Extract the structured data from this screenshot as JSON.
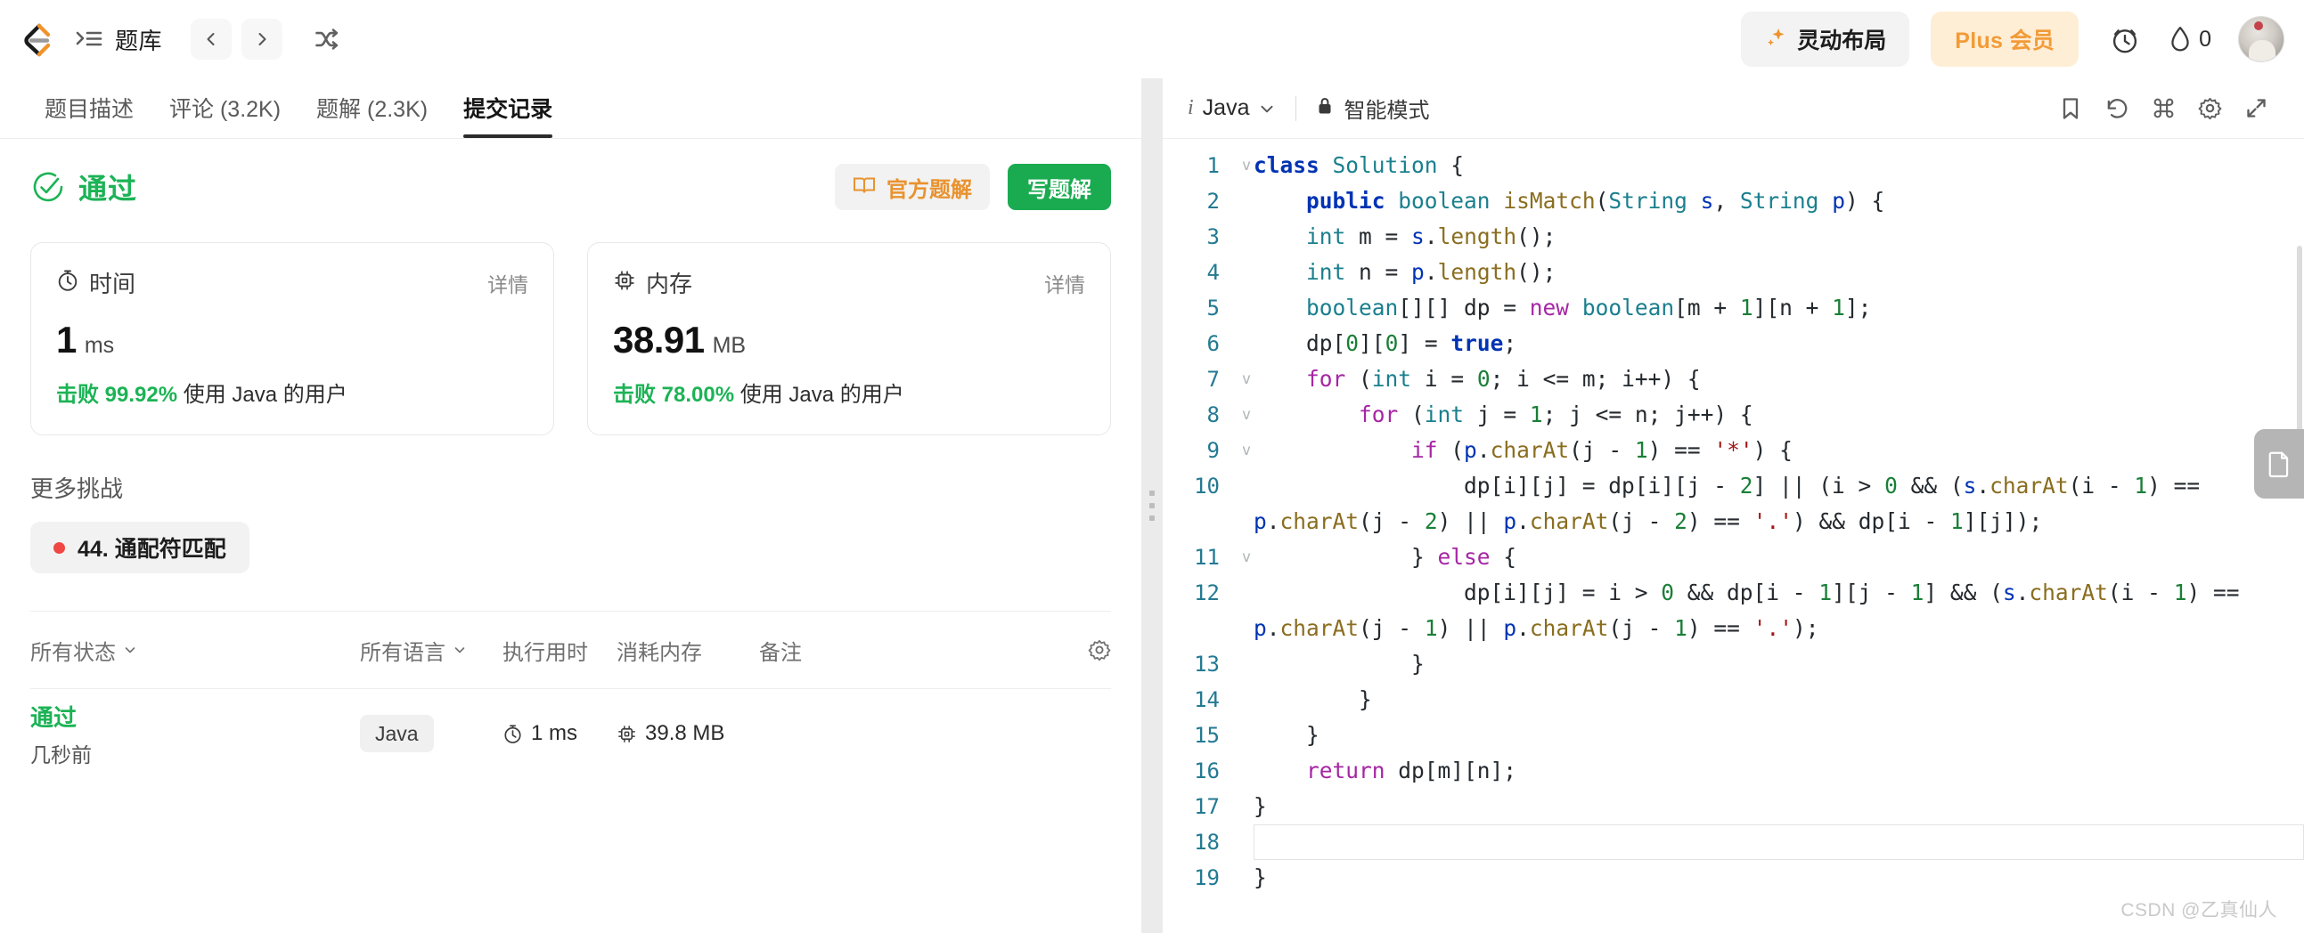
{
  "topbar": {
    "logo_icon": "leetcode-logo",
    "menu_icon": "list-menu-icon",
    "menu_label": "题库",
    "prev_icon": "chevron-left-icon",
    "next_icon": "chevron-right-icon",
    "shuffle_icon": "shuffle-icon",
    "layout_button": {
      "icon": "sparkle-icon",
      "label": "灵动布局"
    },
    "plus_button": {
      "label": "Plus 会员"
    },
    "timer_icon": "alarm-clock-icon",
    "streak": {
      "icon": "flame-icon",
      "count": "0"
    },
    "avatar_icon": "user-avatar"
  },
  "tabs": [
    {
      "label": "题目描述",
      "active": false
    },
    {
      "label": "评论 (3.2K)",
      "active": false
    },
    {
      "label": "题解 (2.3K)",
      "active": false
    },
    {
      "label": "提交记录",
      "active": true
    }
  ],
  "result": {
    "status_icon": "check-circle-icon",
    "status_label": "通过",
    "official_button": {
      "icon": "book-icon",
      "label": "官方题解"
    },
    "write_button": {
      "label": "写题解"
    }
  },
  "stats": [
    {
      "icon": "stopwatch-icon",
      "title": "时间",
      "details_label": "详情",
      "value": "1",
      "unit": "ms",
      "beat_prefix": "击败 99.92%",
      "beat_suffix": "使用 Java 的用户"
    },
    {
      "icon": "memory-chip-icon",
      "title": "内存",
      "details_label": "详情",
      "value": "38.91",
      "unit": "MB",
      "beat_prefix": "击败 78.00%",
      "beat_suffix": "使用 Java 的用户"
    }
  ],
  "more_challenges": {
    "heading": "更多挑战",
    "items": [
      {
        "difficulty_color": "#ef4743",
        "label": "44. 通配符匹配"
      }
    ]
  },
  "submissions": {
    "headers": {
      "status": "所有状态",
      "language": "所有语言",
      "runtime": "执行用时",
      "memory": "消耗内存",
      "note": "备注",
      "settings_icon": "gear-icon",
      "caret_icon": "chevron-down-icon"
    },
    "rows": [
      {
        "status": "通过",
        "time_ago": "几秒前",
        "language": "Java",
        "runtime": "1 ms",
        "runtime_icon": "stopwatch-icon",
        "memory": "39.8 MB",
        "memory_icon": "memory-chip-icon",
        "note": ""
      }
    ]
  },
  "editor": {
    "info_icon": "info-icon",
    "language": "Java",
    "lang_caret": "chevron-down-icon",
    "lock_icon": "lock-icon",
    "mode_label": "智能模式",
    "actions": [
      {
        "icon": "bookmark-icon"
      },
      {
        "icon": "history-undo-icon"
      },
      {
        "icon": "command-icon"
      },
      {
        "icon": "gear-icon"
      },
      {
        "icon": "expand-icon"
      }
    ],
    "file_tab_icon": "document-icon",
    "active_line": 18,
    "lines": [
      {
        "n": "1",
        "fold": "v"
      },
      {
        "n": "2",
        "fold": ""
      },
      {
        "n": "3",
        "fold": ""
      },
      {
        "n": "4",
        "fold": ""
      },
      {
        "n": "5",
        "fold": ""
      },
      {
        "n": "6",
        "fold": ""
      },
      {
        "n": "7",
        "fold": "v"
      },
      {
        "n": "8",
        "fold": "v"
      },
      {
        "n": "9",
        "fold": "v"
      },
      {
        "n": "10",
        "fold": ""
      },
      {
        "n": "11",
        "fold": "v"
      },
      {
        "n": "12",
        "fold": ""
      },
      {
        "n": "13",
        "fold": ""
      },
      {
        "n": "14",
        "fold": ""
      },
      {
        "n": "15",
        "fold": ""
      },
      {
        "n": "16",
        "fold": ""
      },
      {
        "n": "17",
        "fold": ""
      },
      {
        "n": "18",
        "fold": ""
      },
      {
        "n": "19",
        "fold": ""
      }
    ],
    "source": [
      "class Solution {",
      "    public boolean isMatch(String s, String p) {",
      "    int m = s.length();",
      "    int n = p.length();",
      "    boolean[][] dp = new boolean[m + 1][n + 1];",
      "    dp[0][0] = true;",
      "    for (int i = 0; i <= m; i++) {",
      "        for (int j = 1; j <= n; j++) {",
      "            if (p.charAt(j - 1) == '*') {",
      "                dp[i][j] = dp[i][j - 2] || (i > 0 && (s.charAt(i - 1) == p.charAt(j - 2) || p.charAt(j - 2) == '.') && dp[i - 1][j]);",
      "            } else {",
      "                dp[i][j] = i > 0 && dp[i - 1][j - 1] && (s.charAt(i - 1) == p.charAt(j - 1) || p.charAt(j - 1) == '.');",
      "            }",
      "        }",
      "    }",
      "    return dp[m][n];",
      "}",
      "",
      "}"
    ]
  },
  "watermark": "CSDN @乙真仙人"
}
